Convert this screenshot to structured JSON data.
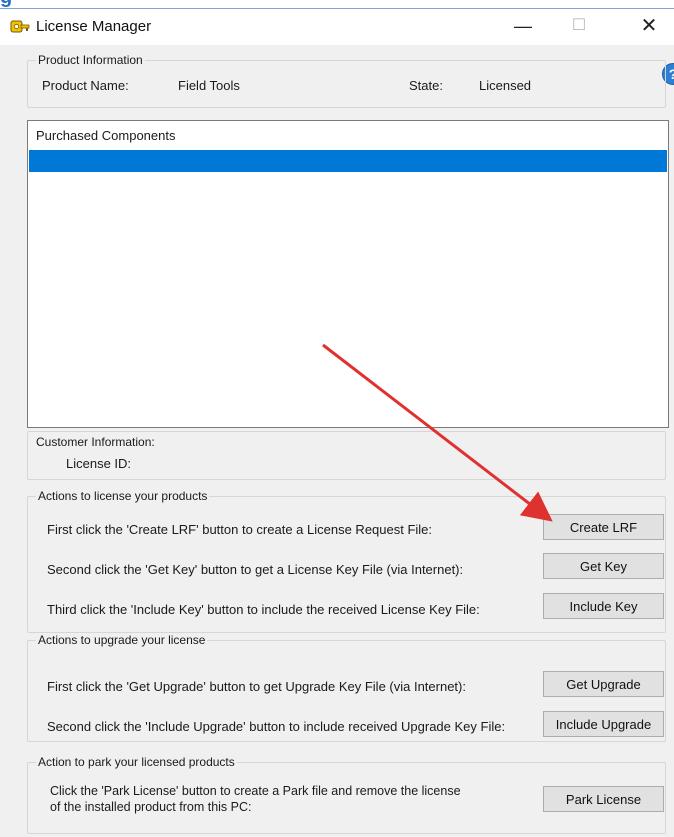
{
  "window": {
    "title": "License Manager",
    "controls": {
      "minimize": "—",
      "maximize": "☐",
      "close": "✕"
    }
  },
  "help_glyph": "?",
  "product_info": {
    "legend": "Product Information",
    "name_label": "Product Name:",
    "name_value": "Field Tools",
    "state_label": "State:",
    "state_value": "Licensed"
  },
  "components": {
    "header": "Purchased Components",
    "selected_row": ""
  },
  "customer_info": {
    "legend": "Customer Information:",
    "license_id_label": "License ID:",
    "license_id_value": ""
  },
  "license_actions": {
    "legend": "Actions to license your products",
    "rows": [
      {
        "text": "First click the 'Create LRF' button to create a License Request File:",
        "button": "Create LRF"
      },
      {
        "text": "Second click the 'Get Key' button to get a License Key File (via Internet):",
        "button": "Get Key"
      },
      {
        "text": "Third click the 'Include Key' button to include the received License Key File:",
        "button": "Include Key"
      }
    ]
  },
  "upgrade_actions": {
    "legend": "Actions to upgrade your license",
    "rows": [
      {
        "text": "First click the 'Get Upgrade' button to get Upgrade Key File (via Internet):",
        "button": "Get Upgrade"
      },
      {
        "text": "Second click the 'Include Upgrade' button to include received Upgrade Key File:",
        "button": "Include Upgrade"
      }
    ]
  },
  "park_actions": {
    "legend": "Action to park your licensed products",
    "text_line1": "Click the 'Park License' button to create a Park file and remove the license",
    "text_line2": "of the installed product from this PC:",
    "button": "Park License"
  },
  "annotation": {
    "arrow_color": "#e03131"
  }
}
